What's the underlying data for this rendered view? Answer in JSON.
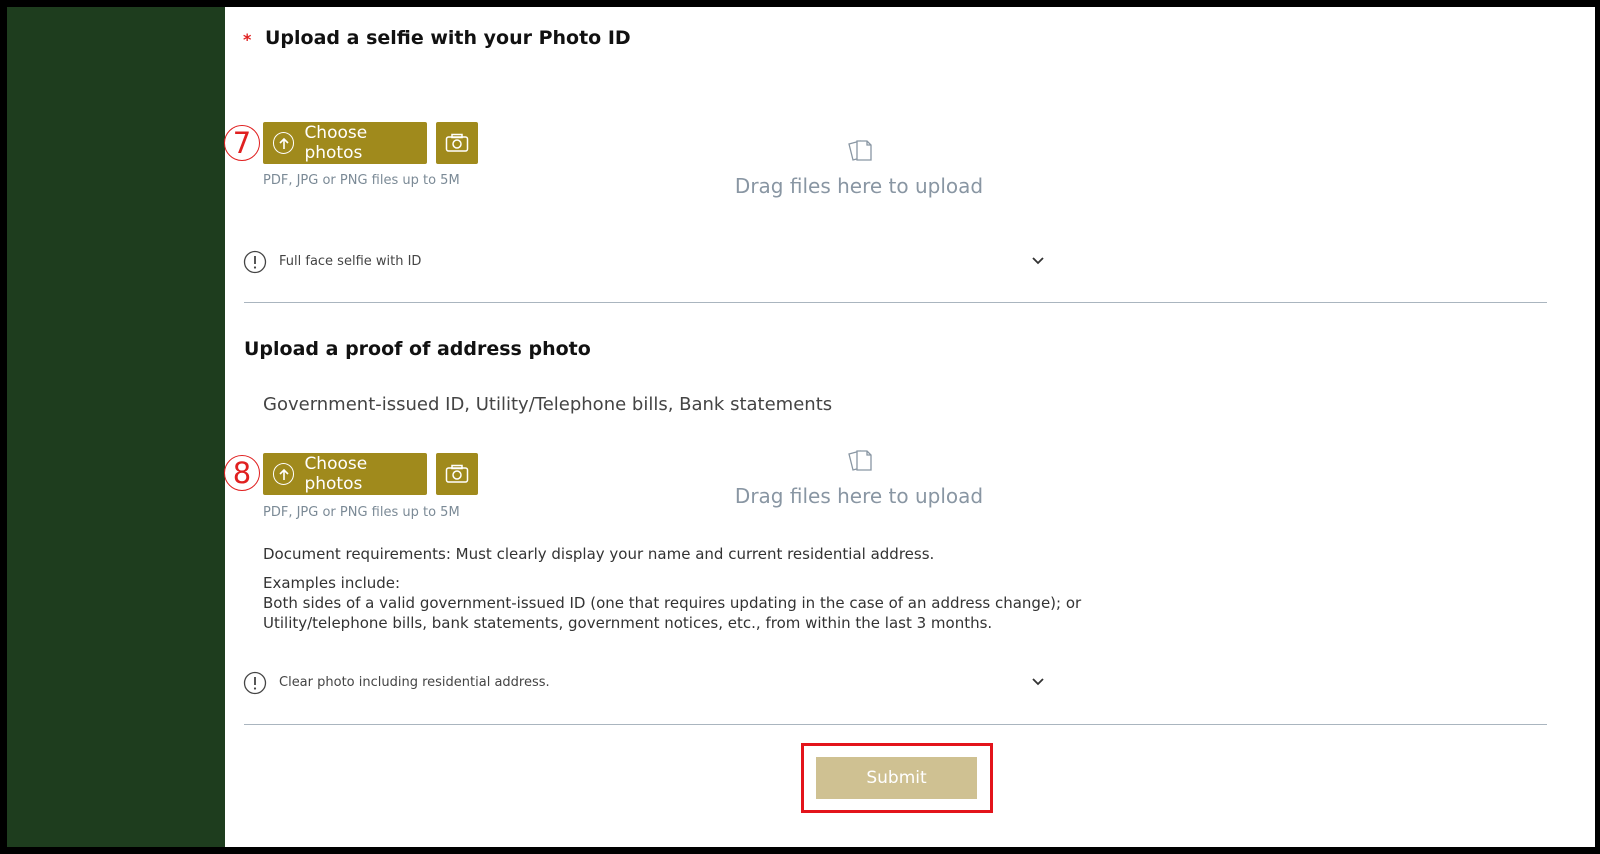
{
  "section1": {
    "required_mark": "*",
    "title": "Upload a selfie with your Photo ID",
    "step_number": "7",
    "choose_label": "Choose photos",
    "file_hint": "PDF, JPG or PNG files up to 5M",
    "drop_label": "Drag files here to upload",
    "info_label": "Full face selfie with ID"
  },
  "section2": {
    "title": "Upload a proof of address photo",
    "subtitle": "Government-issued ID, Utility/Telephone bills, Bank statements",
    "step_number": "8",
    "choose_label": "Choose photos",
    "file_hint": "PDF, JPG or PNG files up to 5M",
    "drop_label": "Drag files here to upload",
    "requirements": "Document requirements: Must clearly display your name and current residential address.",
    "examples_heading": "Examples include:",
    "examples": [
      "Both sides of a valid government-issued ID (one that requires updating in the case of an address change); or",
      "Utility/telephone bills, bank statements, government notices, etc., from within the last 3 months."
    ],
    "info_label": "Clear photo including residential address."
  },
  "submit_label": "Submit",
  "colors": {
    "sidebar": "#1e3d1e",
    "button": "#a08a1c",
    "submit": "#cfc192",
    "annotation_red": "#e3141b"
  },
  "icons": {
    "upload": "upload-circle-icon",
    "camera": "camera-icon",
    "files": "files-icon",
    "info": "exclamation-circle-icon",
    "chevron": "chevron-down-icon"
  }
}
